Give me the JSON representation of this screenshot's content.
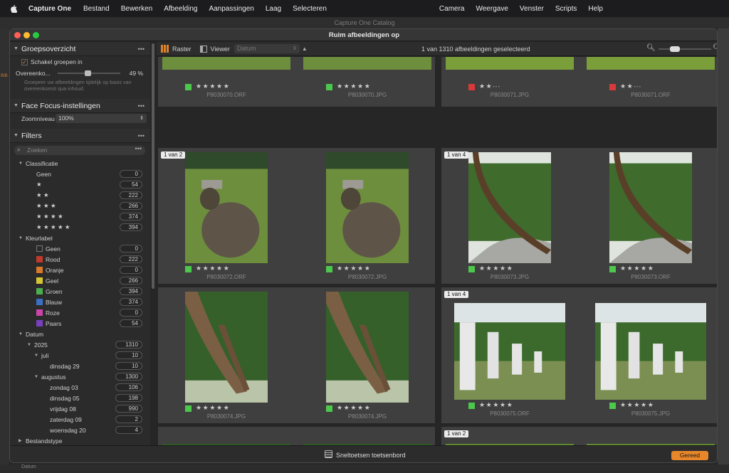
{
  "menubar": {
    "app": "Capture One",
    "items": [
      "Bestand",
      "Bewerken",
      "Afbeelding",
      "Aanpassingen",
      "Laag",
      "Selecteren",
      "Camera",
      "Weergave",
      "Venster",
      "Scripts",
      "Help"
    ]
  },
  "bg_window": {
    "title": "Capture One Catalog",
    "left_label": "BIB",
    "bottom_label": "Datum"
  },
  "window": {
    "title": "Ruim afbeeldingen op"
  },
  "sidebar": {
    "groups_title": "Groepsoverzicht",
    "group_toggle": "Schakel groepen in",
    "similarity_label": "Overeenko...",
    "similarity_value": "49 %",
    "groups_hint": "Groepeer uw afbeeldingen tijdelijk op basis van overeenkomst qua inhoud.",
    "face_title": "Face Focus-instellingen",
    "zoom_label": "Zoomniveau",
    "zoom_value": "100%",
    "filters_title": "Filters",
    "search_placeholder": "Zoeken",
    "classification_title": "Classificatie",
    "classification": [
      {
        "label": "Geen",
        "count": "0"
      },
      {
        "label": "★",
        "count": "54"
      },
      {
        "label": "★ ★",
        "count": "222"
      },
      {
        "label": "★ ★ ★",
        "count": "266"
      },
      {
        "label": "★ ★ ★ ★",
        "count": "374"
      },
      {
        "label": "★ ★ ★ ★ ★",
        "count": "394"
      }
    ],
    "colorlabel_title": "Kleurlabel",
    "colorlabels": [
      {
        "label": "Geen",
        "count": "0",
        "color": "none"
      },
      {
        "label": "Rood",
        "count": "222",
        "color": "#c0392b"
      },
      {
        "label": "Oranje",
        "count": "0",
        "color": "#d9782a"
      },
      {
        "label": "Geel",
        "count": "266",
        "color": "#d4c534"
      },
      {
        "label": "Groen",
        "count": "394",
        "color": "#4cae4c"
      },
      {
        "label": "Blauw",
        "count": "374",
        "color": "#3a6fc4"
      },
      {
        "label": "Roze",
        "count": "0",
        "color": "#cc44aa"
      },
      {
        "label": "Paars",
        "count": "54",
        "color": "#7a3fbf"
      }
    ],
    "date_title": "Datum",
    "dates": [
      {
        "label": "2025",
        "count": "1310",
        "level": 1
      },
      {
        "label": "juli",
        "count": "10",
        "level": 2
      },
      {
        "label": "dinsdag 29",
        "count": "10",
        "level": 3
      },
      {
        "label": "augustus",
        "count": "1300",
        "level": 2
      },
      {
        "label": "zondag 03",
        "count": "106",
        "level": 3
      },
      {
        "label": "dinsdag 05",
        "count": "198",
        "level": 3
      },
      {
        "label": "vrijdag 08",
        "count": "990",
        "level": 3
      },
      {
        "label": "zaterdag 09",
        "count": "2",
        "level": 3
      },
      {
        "label": "woensdag 20",
        "count": "4",
        "level": 3
      }
    ],
    "filetype_title": "Bestandstype"
  },
  "toolbar": {
    "grid_label": "Raster",
    "viewer_label": "Viewer",
    "sort_value": "Datum",
    "selection_status": "1 van 1310 afbeeldingen geselecteerd"
  },
  "cells": [
    {
      "badge": "",
      "label": "G",
      "images": [
        {
          "file": "P8030070.ORF",
          "label": "G",
          "stars": 5
        },
        {
          "file": "P8030070.JPG",
          "label": "G",
          "stars": 5
        }
      ]
    },
    {
      "badge": "",
      "label": "R",
      "images": [
        {
          "file": "P8030071.JPG",
          "label": "R",
          "stars": 2
        },
        {
          "file": "P8030071.ORF",
          "label": "R",
          "stars": 2
        }
      ]
    },
    {
      "badge": "1 van 2",
      "label": "G",
      "images": [
        {
          "file": "P8030072.ORF",
          "label": "G",
          "stars": 5
        },
        {
          "file": "P8030072.JPG",
          "label": "G",
          "stars": 5
        }
      ]
    },
    {
      "badge": "1 van 4",
      "label": "G",
      "images": [
        {
          "file": "P8030073.JPG",
          "label": "G",
          "stars": 5
        },
        {
          "file": "P8030073.ORF",
          "label": "G",
          "stars": 5
        }
      ]
    },
    {
      "badge": "",
      "label": "G",
      "images": [
        {
          "file": "P8030074.JPG",
          "label": "G",
          "stars": 5
        },
        {
          "file": "P8030074.JPG",
          "label": "G",
          "stars": 5
        }
      ]
    },
    {
      "badge": "1 van 4",
      "label": "G",
      "images": [
        {
          "file": "P8030075.ORF",
          "label": "G",
          "stars": 5
        },
        {
          "file": "P8030075.JPG",
          "label": "G",
          "stars": 5
        }
      ]
    },
    {
      "badge": "",
      "label": "",
      "images": []
    },
    {
      "badge": "1 van 2",
      "label": "",
      "images": []
    }
  ],
  "bottom": {
    "shortcuts": "Sneltoetsen toetsenbord",
    "ready": "Gereed"
  },
  "colors": {
    "accent": "#e8862a",
    "green": "#4cc94c",
    "red": "#d83a3a"
  }
}
